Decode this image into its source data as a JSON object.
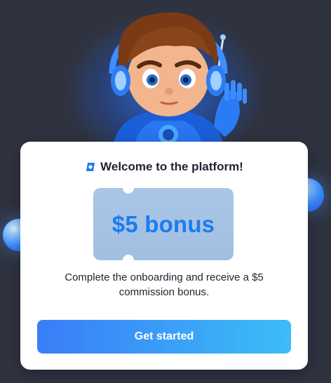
{
  "header": {
    "mascot_icon": "astronaut-mascot-waving"
  },
  "card": {
    "title": "Welcome to the platform!",
    "logo_icon": "brand-logo-icon",
    "bonus_label": "$5 bonus",
    "description": "Complete the onboarding and receive a $5 commission bonus.",
    "cta_label": "Get started"
  },
  "colors": {
    "background": "#2f3340",
    "accent": "#1a7cf0",
    "button_start": "#3a7df8",
    "button_end": "#3cbdf8",
    "ticket": "#a9c6e6"
  }
}
